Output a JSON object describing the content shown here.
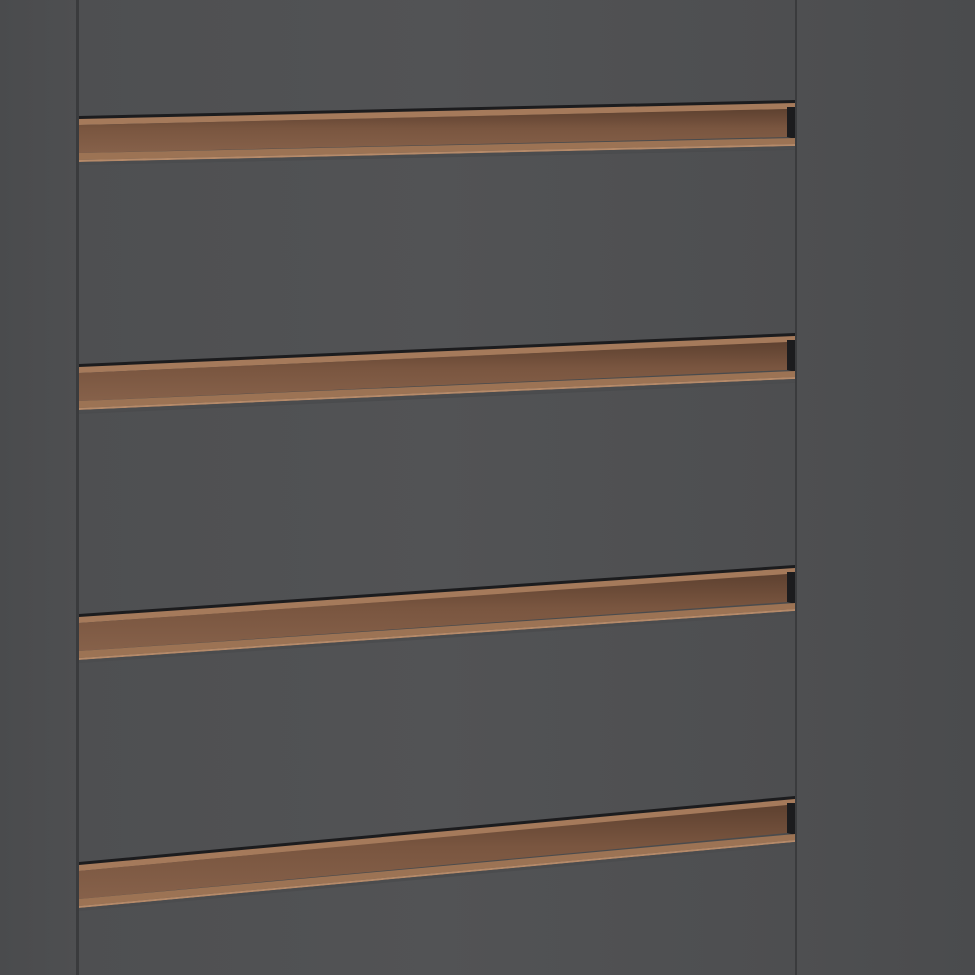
{
  "image": {
    "subject": "cabinet-drawer-fronts",
    "colors": {
      "background": "#4a4b4d",
      "side_panel": "#4c4d4f",
      "drawer_front": "#505153",
      "drawer_front_dark": "#4b4c4e",
      "frame_edge": "#3a3b3d",
      "gap_shadow": "#1c1c1e",
      "handle_top_lip": "#a57a5b",
      "handle_channel": "#7a5640",
      "handle_channel_dark": "#5e4130",
      "handle_bottom_lip": "#9c7354",
      "handle_bottom_highlight": "#b68a69"
    },
    "drawers": [
      {
        "name": "drawer-1"
      },
      {
        "name": "drawer-2"
      },
      {
        "name": "drawer-3"
      },
      {
        "name": "drawer-4"
      },
      {
        "name": "drawer-5"
      }
    ],
    "handles": [
      {
        "name": "handle-1"
      },
      {
        "name": "handle-2"
      },
      {
        "name": "handle-3"
      },
      {
        "name": "handle-4"
      }
    ]
  }
}
